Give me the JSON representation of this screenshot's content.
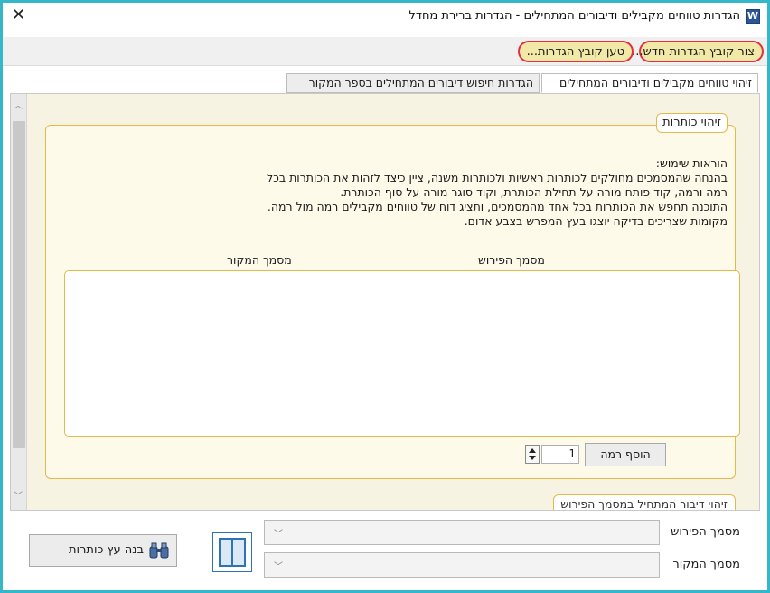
{
  "window": {
    "title": "הגדרות טווחים מקבילים ודיבורים המתחילים - הגדרות ברירת מחדל",
    "app_icon_letter": "W",
    "close_glyph": "✕"
  },
  "menu": {
    "new_settings_file": "צור קובץ הגדרות חדש...",
    "load_settings_file": "טען קובץ הגדרות..."
  },
  "tabs": {
    "active": "זיהוי טווחים מקבילים ודיבורים המתחילים",
    "inactive": "הגדרות חיפוש דיבורים המתחילים בספר המקור"
  },
  "heading_group": {
    "legend": "זיהוי כותרות",
    "instructions": [
      "הוראות שימוש:",
      "בהנחה שהמסמכים מחולקים לכותרות ראשיות ולכותרות משנה, ציין כיצד לזהות את הכותרות בכל",
      "רמה ורמה, קוד פותח מורה על תחילת הכותרת, וקוד סוגר מורה על סוף הכותרת.",
      "התוכנה תחפש את הכותרות בכל אחד מהמסמכים, ותציג דוח של טווחים מקבילים רמה מול רמה.",
      "מקומות שצריכים בדיקה יוצגו בעץ המפרש בצבע אדום."
    ],
    "column_commentary": "מסמך הפירוש",
    "column_source": "מסמך המקור",
    "add_level_button": "הוסף רמה",
    "level_value": "1"
  },
  "second_group": {
    "legend": "זיהוי דיבור המתחיל במסמך הפירוש"
  },
  "bottom": {
    "commentary_doc_label": "מסמך הפירוש",
    "source_doc_label": "מסמך המקור",
    "commentary_doc_value": "",
    "source_doc_value": "",
    "build_tree_button": "בנה עץ כותרות"
  },
  "icons": {
    "app": "word-icon",
    "close": "close-icon",
    "scroll_up": "chevron-up-icon",
    "scroll_down": "chevron-down-icon",
    "layout": "split-view-icon",
    "build": "binoculars-icon"
  },
  "colors": {
    "window_border": "#34b7c8",
    "highlight_outline": "#e32f3f",
    "highlight_fill": "#f2e8a8",
    "group_border": "#e3b94a",
    "panel_bg": "#f7f3e2"
  }
}
